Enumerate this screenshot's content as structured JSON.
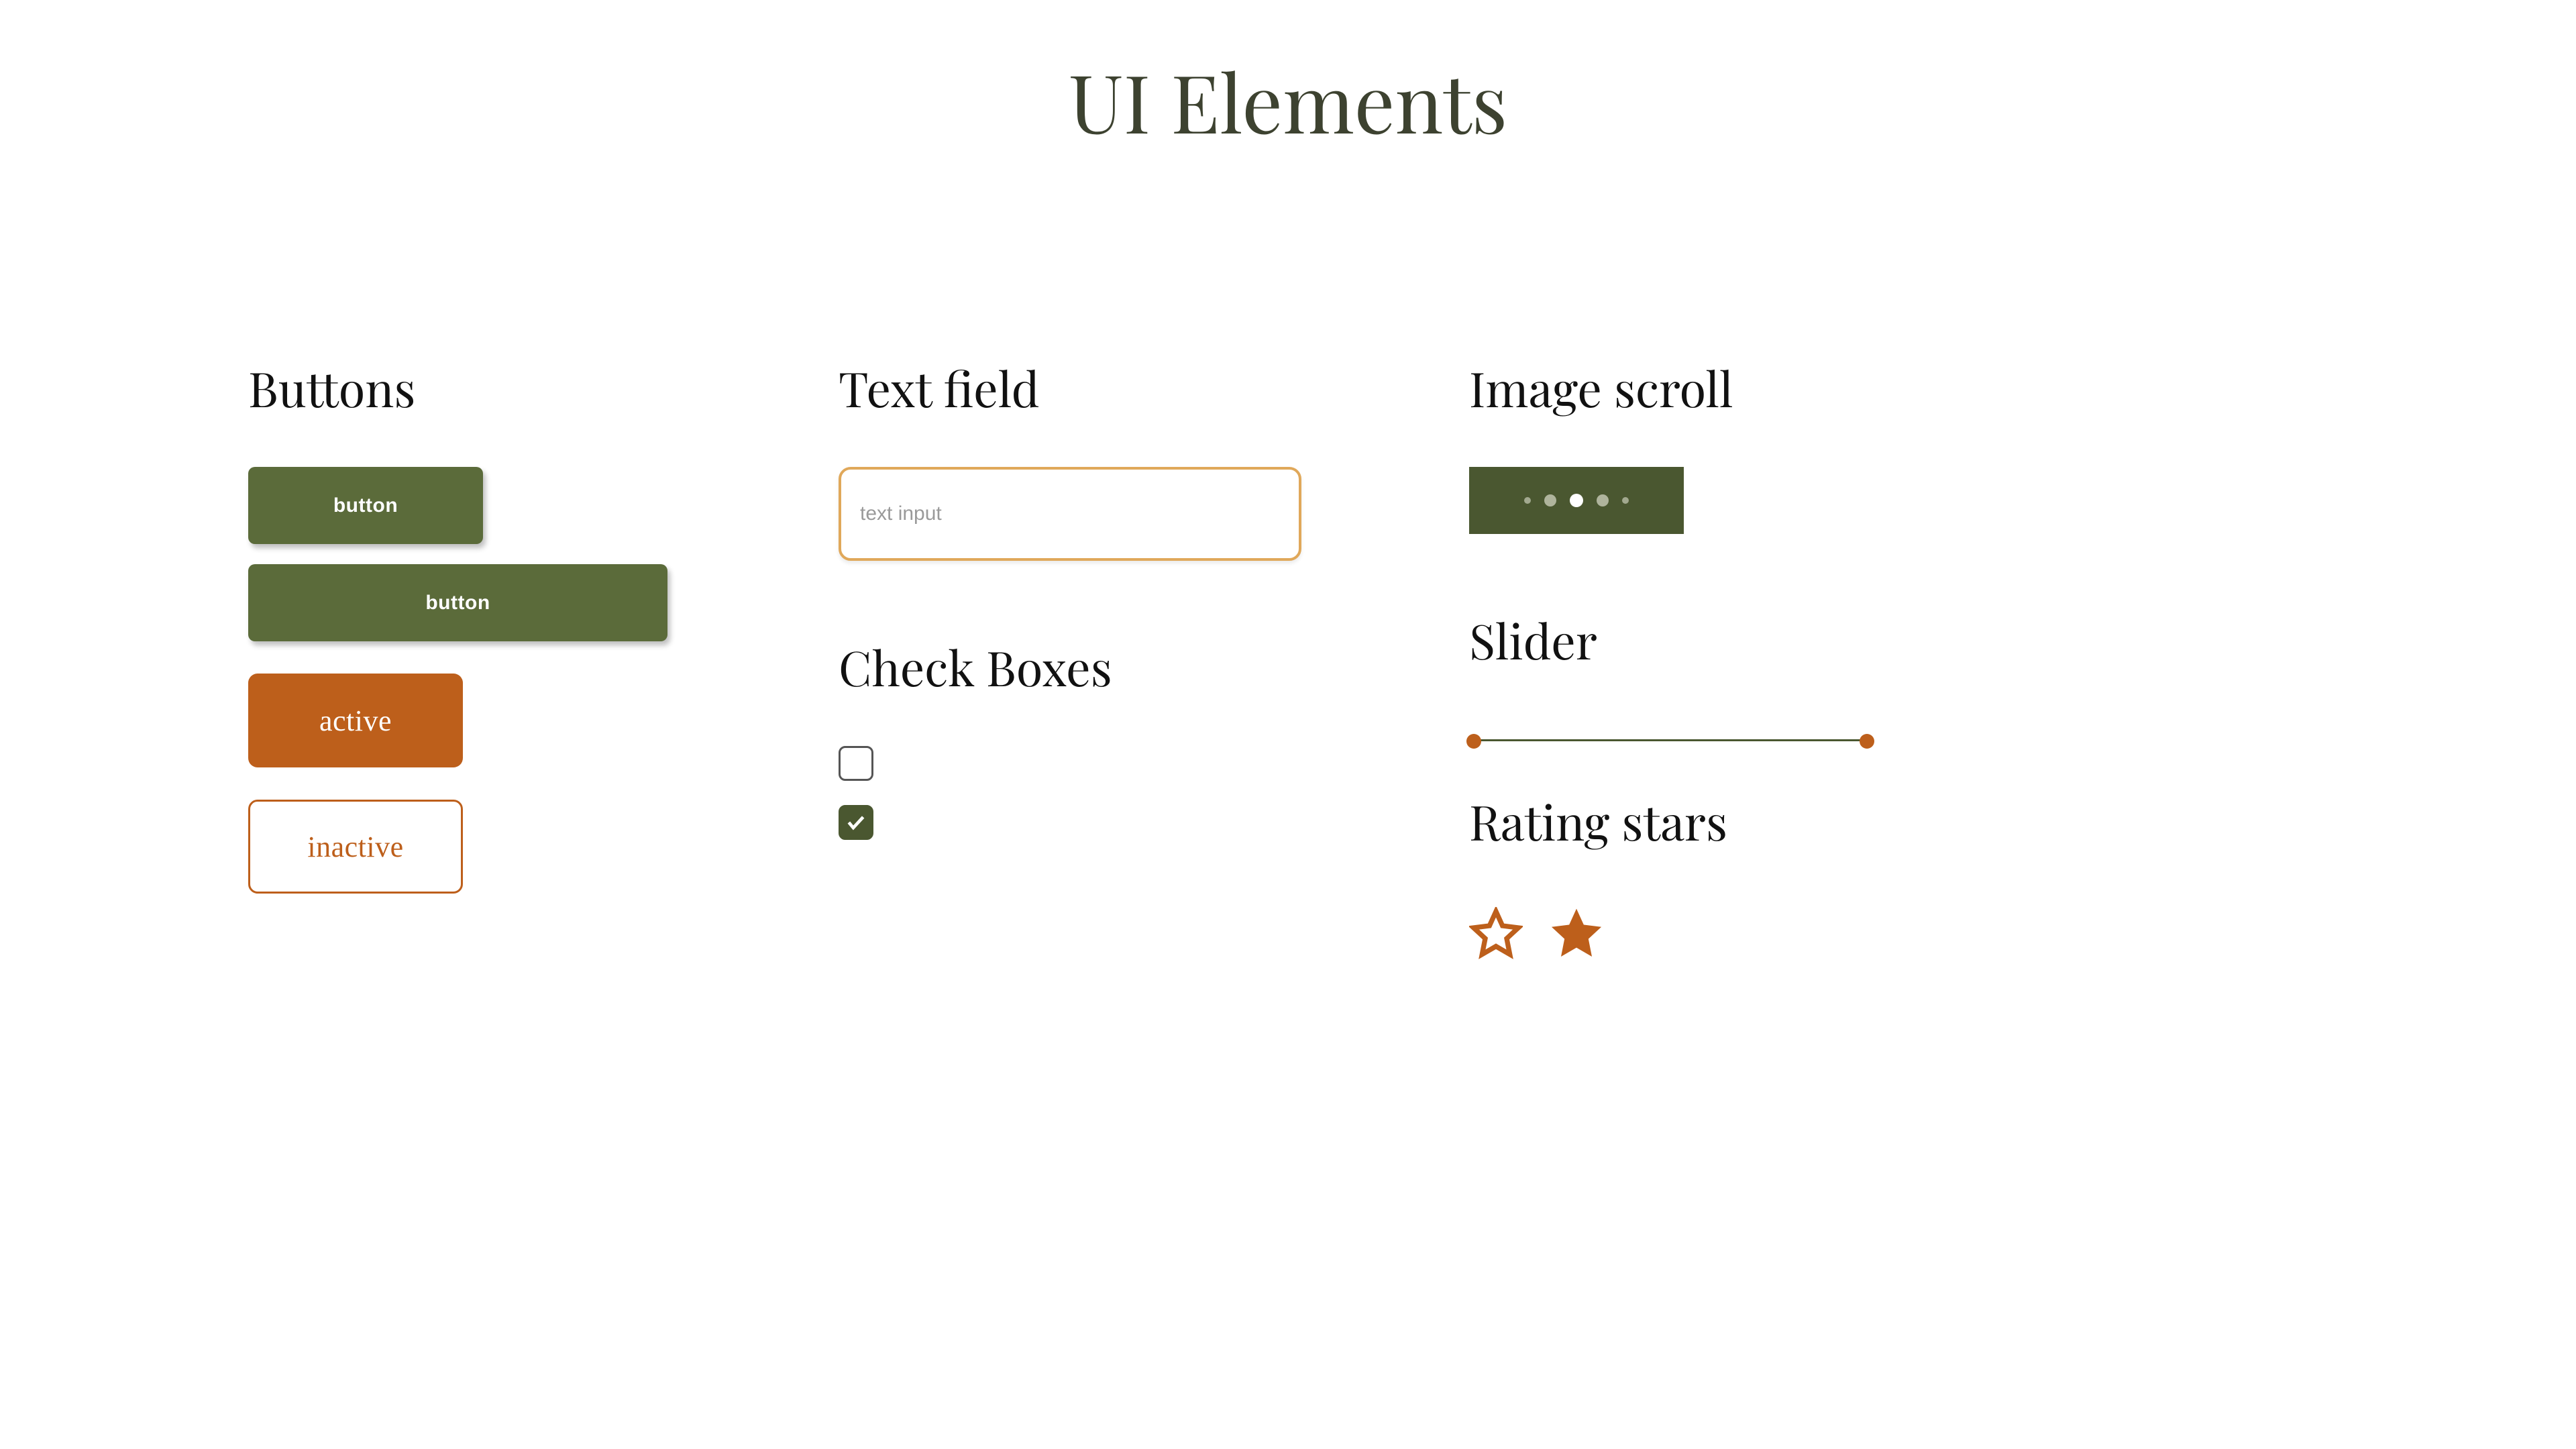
{
  "title": "UI Elements",
  "sections": {
    "buttons": "Buttons",
    "text_field": "Text field",
    "check_boxes": "Check Boxes",
    "image_scroll": "Image scroll",
    "slider": "Slider",
    "rating_stars": "Rating stars"
  },
  "buttons": {
    "primary_sm": "button",
    "primary_lg": "button",
    "active": "active",
    "inactive": "inactive"
  },
  "text_field": {
    "placeholder": "text input",
    "value": ""
  },
  "checkboxes": {
    "unchecked": false,
    "checked": true
  },
  "image_scroll": {
    "dots": 5,
    "active_index": 2
  },
  "slider": {
    "min": 0,
    "max": 100,
    "value_low": 0,
    "value_high": 100
  },
  "rating": {
    "outline_star": "star-outline",
    "filled_star": "star-filled"
  },
  "colors": {
    "olive": "#5b6b3a",
    "olive_dark": "#4a5730",
    "orange": "#bd5f1b"
  }
}
